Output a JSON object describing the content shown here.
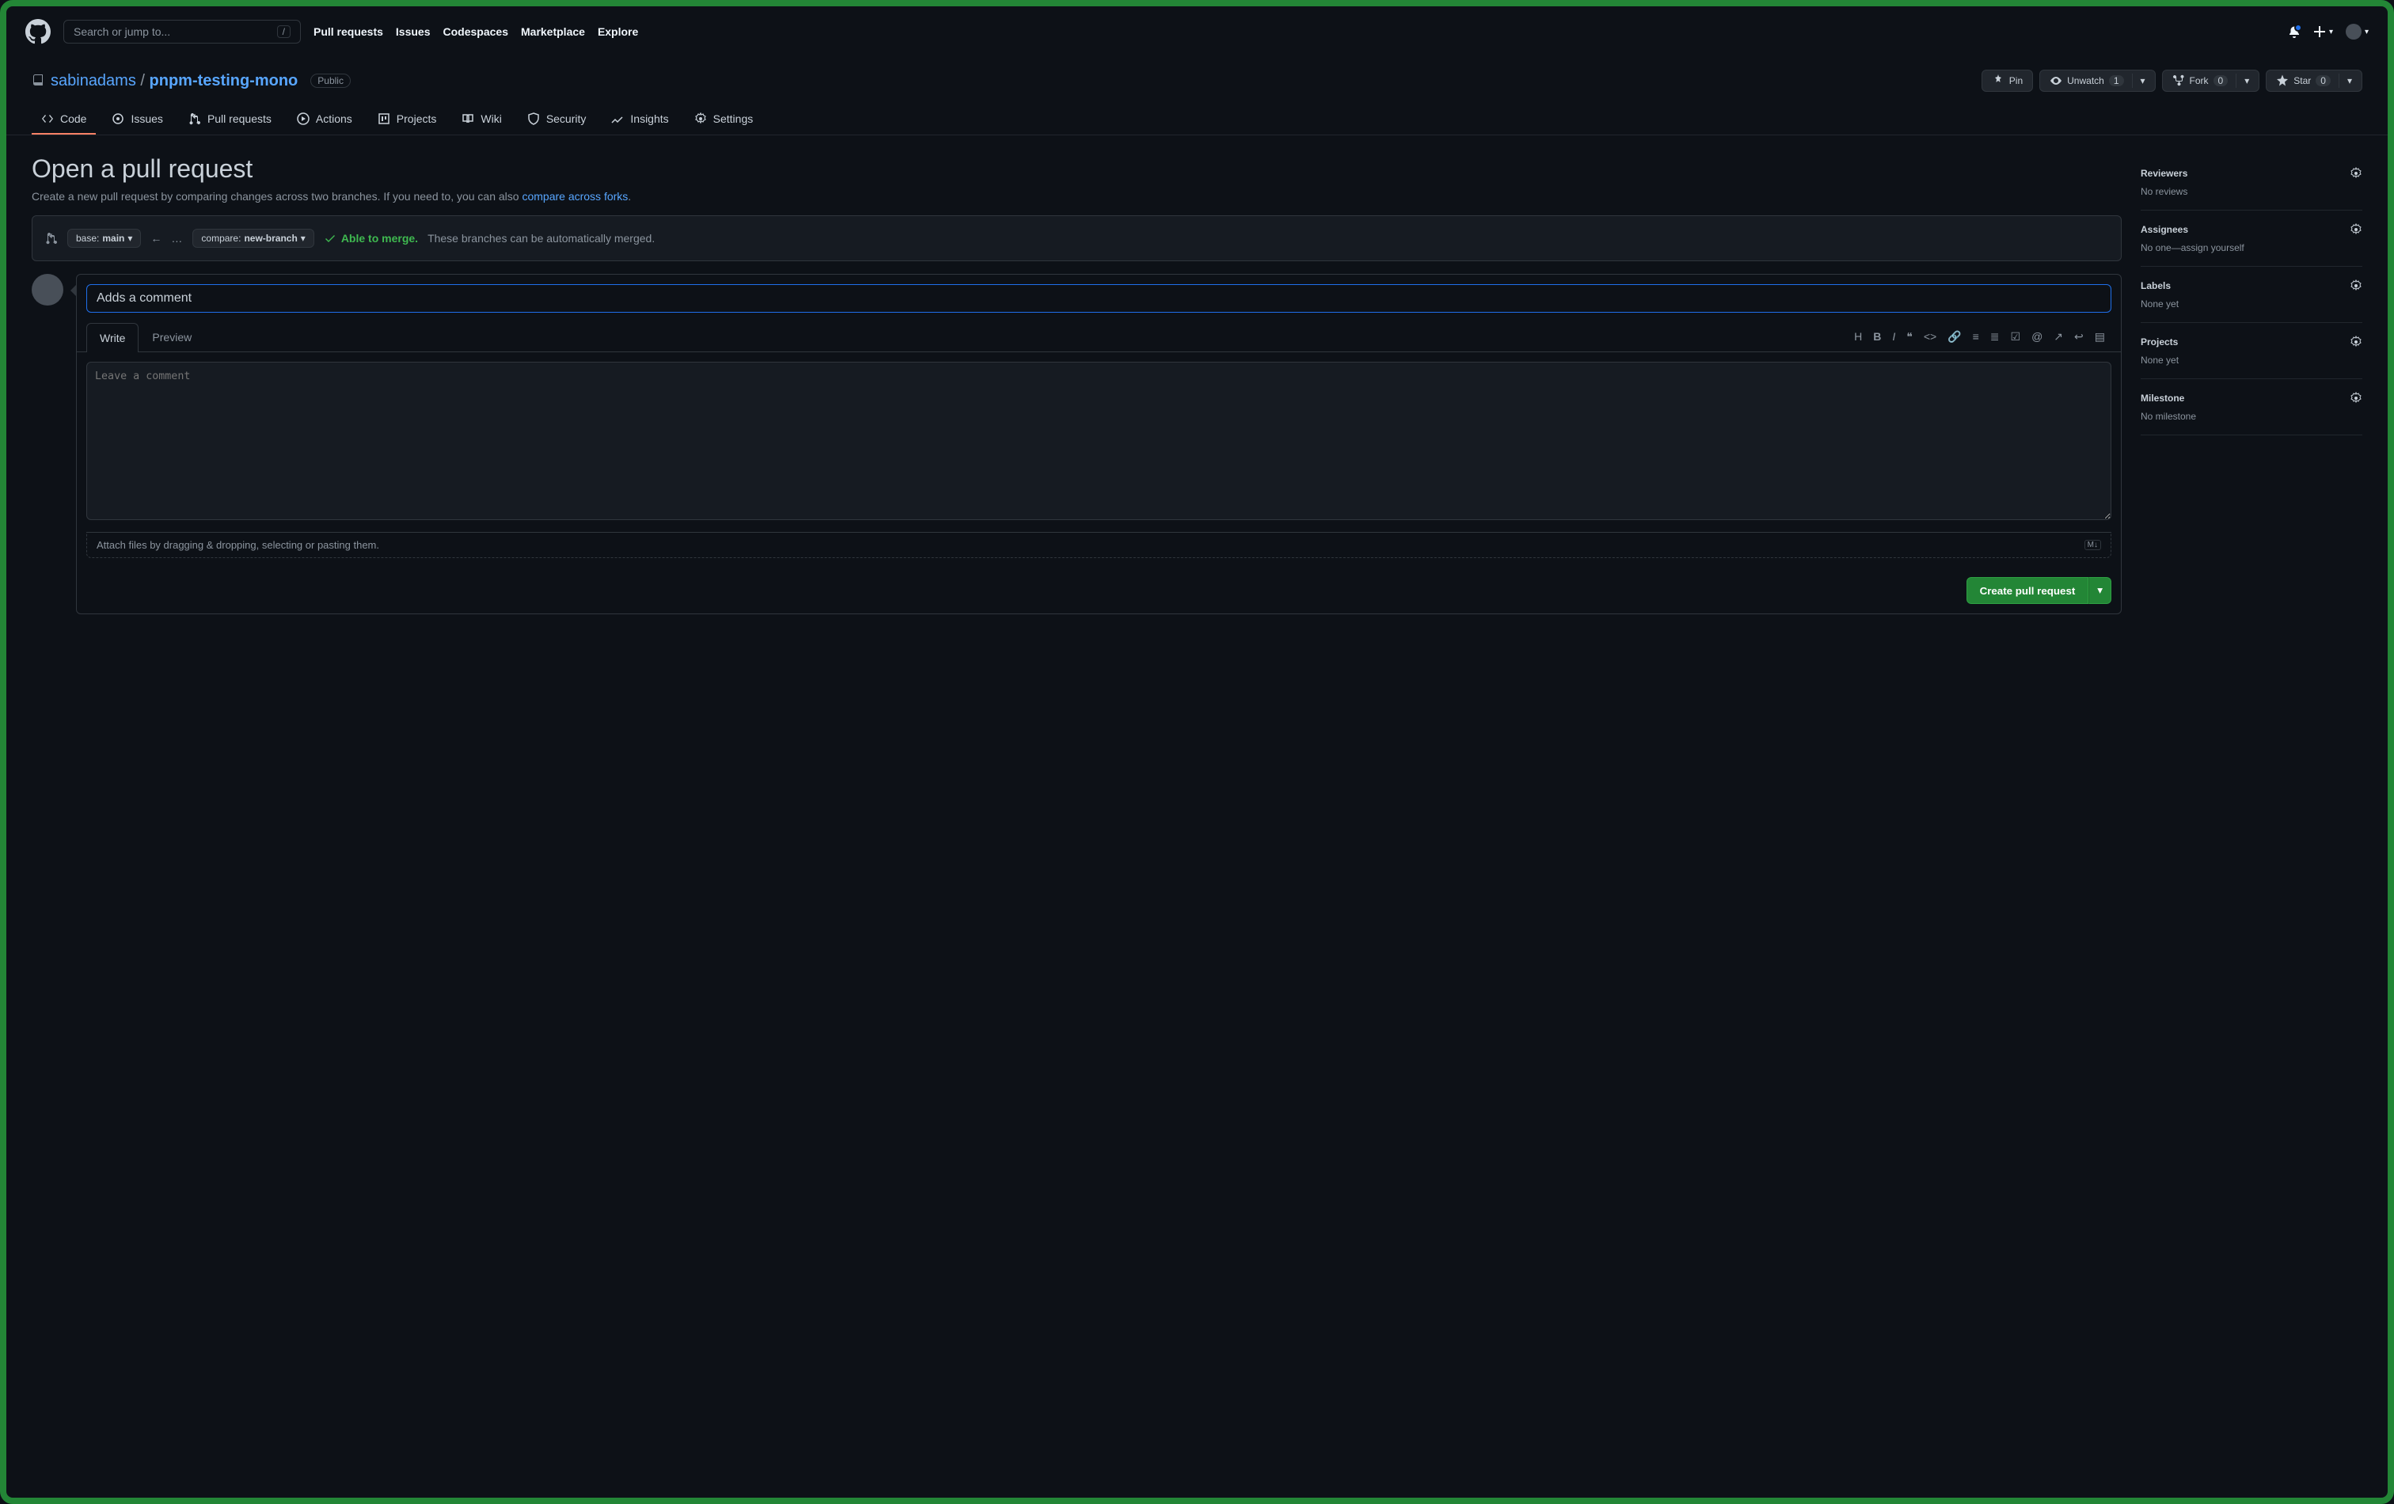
{
  "header": {
    "search_placeholder": "Search or jump to...",
    "slash": "/",
    "nav": [
      "Pull requests",
      "Issues",
      "Codespaces",
      "Marketplace",
      "Explore"
    ]
  },
  "repo": {
    "owner": "sabinadams",
    "name": "pnpm-testing-mono",
    "visibility": "Public",
    "actions": {
      "pin": "Pin",
      "unwatch": "Unwatch",
      "unwatch_count": "1",
      "fork": "Fork",
      "fork_count": "0",
      "star": "Star",
      "star_count": "0"
    },
    "tabs": [
      "Code",
      "Issues",
      "Pull requests",
      "Actions",
      "Projects",
      "Wiki",
      "Security",
      "Insights",
      "Settings"
    ]
  },
  "page": {
    "title": "Open a pull request",
    "subtitle_prefix": "Create a new pull request by comparing changes across two branches. If you need to, you can also ",
    "subtitle_link": "compare across forks",
    "subtitle_suffix": "."
  },
  "compare": {
    "base_label": "base:",
    "base_value": "main",
    "compare_label": "compare:",
    "compare_value": "new-branch",
    "ok_label": "Able to merge.",
    "ok_msg": "These branches can be automatically merged."
  },
  "form": {
    "title_value": "Adds a comment",
    "tabs": {
      "write": "Write",
      "preview": "Preview"
    },
    "comment_placeholder": "Leave a comment",
    "attach_hint": "Attach files by dragging & dropping, selecting or pasting them.",
    "submit": "Create pull request"
  },
  "sidebar": {
    "reviewers": {
      "title": "Reviewers",
      "body": "No reviews"
    },
    "assignees": {
      "title": "Assignees",
      "body_prefix": "No one—",
      "body_link": "assign yourself"
    },
    "labels": {
      "title": "Labels",
      "body": "None yet"
    },
    "projects": {
      "title": "Projects",
      "body": "None yet"
    },
    "milestone": {
      "title": "Milestone",
      "body": "No milestone"
    }
  }
}
